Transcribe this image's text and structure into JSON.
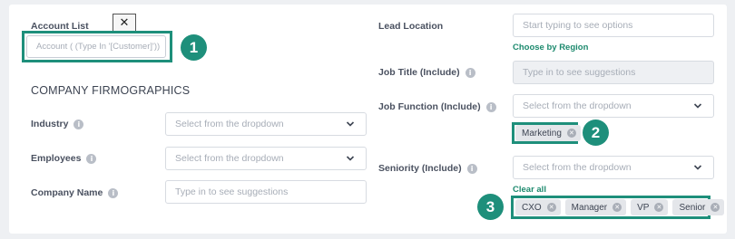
{
  "left": {
    "account_list_label": "Account List",
    "close_glyph": "✕",
    "account_input_placeholder": "Account ( (Type In '[Customer]'))",
    "section_heading": "COMPANY FIRMOGRAPHICS",
    "industry_label": "Industry",
    "industry_placeholder": "Select from the dropdown",
    "employees_label": "Employees",
    "employees_placeholder": "Select from the dropdown",
    "company_name_label": "Company Name",
    "company_name_placeholder": "Type in to see suggestions"
  },
  "right": {
    "lead_location_label": "Lead Location",
    "lead_location_placeholder": "Start typing to see options",
    "choose_by_region": "Choose by Region",
    "job_title_label": "Job Title (Include)",
    "job_title_placeholder": "Type in to see suggestions",
    "job_function_label": "Job Function (Include)",
    "job_function_placeholder": "Select from the dropdown",
    "job_function_chips": [
      "Marketing"
    ],
    "seniority_label": "Seniority (Include)",
    "seniority_placeholder": "Select from the dropdown",
    "clear_all": "Clear all",
    "seniority_chips": [
      "CXO",
      "Manager",
      "VP",
      "Senior"
    ]
  },
  "annotations": {
    "badge1": "1",
    "badge2": "2",
    "badge3": "3"
  },
  "icons": {
    "info": "info-icon",
    "chevron": "chevron-down-icon",
    "chip_remove": "remove-icon",
    "close": "close-icon"
  },
  "colors": {
    "accent_teal": "#1e8f7b",
    "link_green": "#1d8a6e",
    "background": "#eef0f3"
  }
}
